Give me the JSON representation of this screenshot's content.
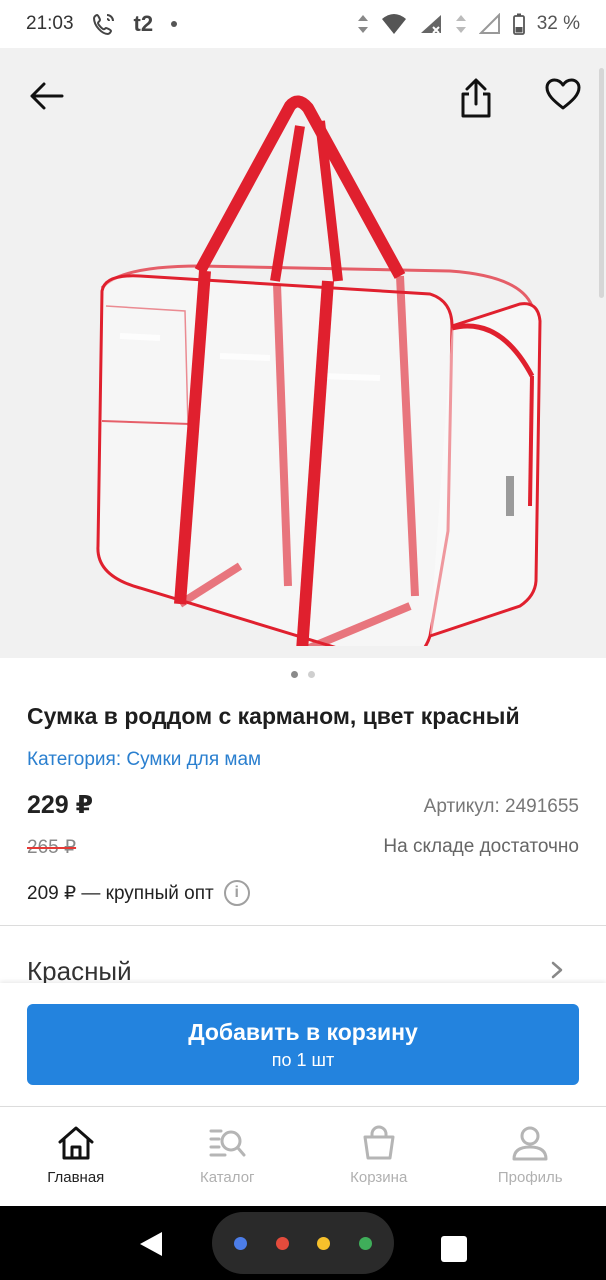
{
  "status_bar": {
    "time": "21:03",
    "carrier": "t2",
    "battery": "32 %"
  },
  "product": {
    "title": "Сумка в роддом с карманом, цвет красный",
    "category": "Категория: Сумки для мам",
    "price": "229 ₽",
    "article": "Артикул: 2491655",
    "old_price": "265 ₽",
    "stock": "На складе достаточно",
    "wholesale": "209 ₽ — крупный опт",
    "color": "Красный",
    "image_count": 2,
    "active_image": 1
  },
  "cart": {
    "button_label": "Добавить в корзину",
    "quantity_label": "по 1 шт"
  },
  "nav": {
    "items": [
      {
        "label": "Главная",
        "icon": "home-icon",
        "active": true
      },
      {
        "label": "Каталог",
        "icon": "catalog-search-icon",
        "active": false
      },
      {
        "label": "Корзина",
        "icon": "cart-bag-icon",
        "active": false
      },
      {
        "label": "Профиль",
        "icon": "profile-icon",
        "active": false
      }
    ]
  },
  "colors": {
    "accent": "#2383de",
    "category_link": "#2a7fcf",
    "bag_trim": "#e0202e",
    "assistant_dots": [
      "#4c7de8",
      "#e44b3c",
      "#f6c02b",
      "#3fae5a"
    ]
  }
}
